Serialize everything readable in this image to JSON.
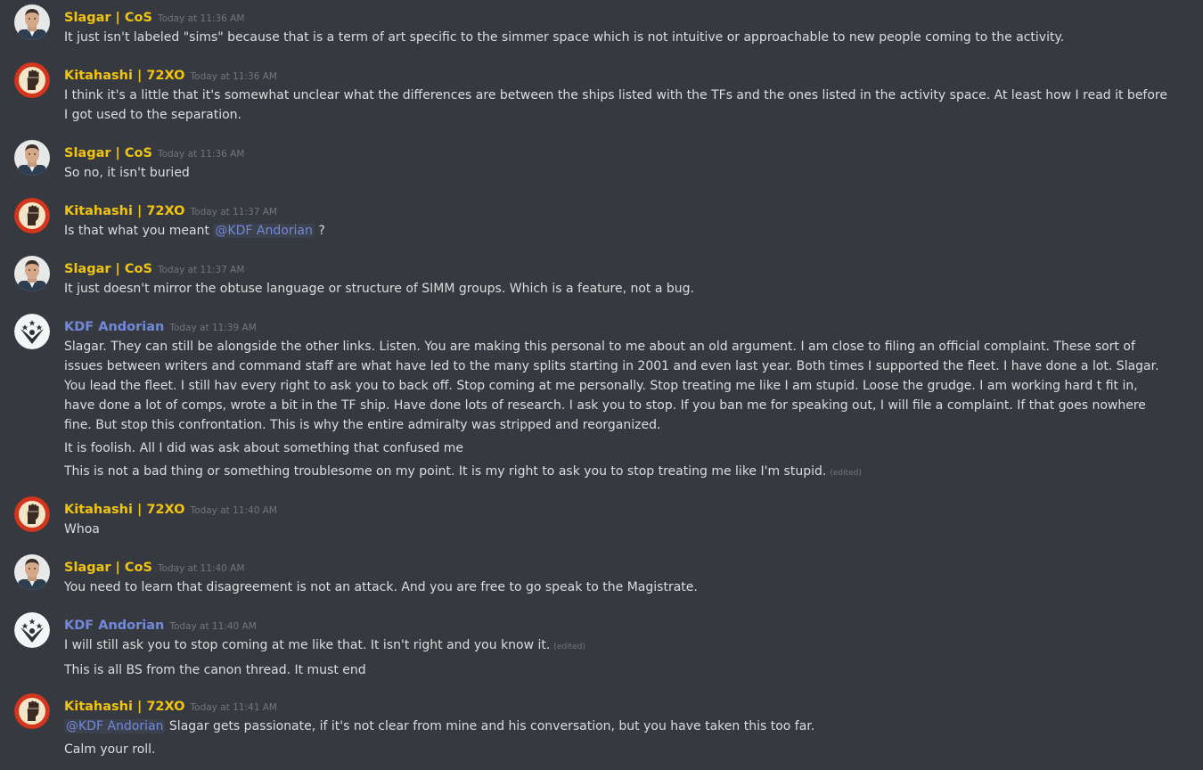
{
  "colors": {
    "background": "#36393f",
    "text": "#dcddde",
    "timestamp": "#72767d",
    "mention": "#7289da",
    "username_gold": "#f1c40f",
    "username_blue": "#7289da"
  },
  "messages": [
    {
      "author": "Slagar | CoS",
      "author_color": "#f1c40f",
      "avatar": "slagar-avatar",
      "time": "Today at 11:36 AM",
      "lines": [
        {
          "text": "It just isn't labeled \"sims\" because that is a term of art specific to the simmer space which is not intuitive or approachable to new people coming to the activity."
        }
      ]
    },
    {
      "author": "Kitahashi | 72XO",
      "author_color": "#f1c40f",
      "avatar": "fist-avatar",
      "time": "Today at 11:36 AM",
      "lines": [
        {
          "text": "I think it's a little that it's somewhat unclear what the differences are between the ships listed with the TFs and the ones listed in the activity space. At least how I read it before I got used to the separation."
        }
      ]
    },
    {
      "author": "Slagar | CoS",
      "author_color": "#f1c40f",
      "avatar": "slagar-avatar",
      "time": "Today at 11:36 AM",
      "lines": [
        {
          "text": "So no, it isn't buried"
        }
      ]
    },
    {
      "author": "Kitahashi | 72XO",
      "author_color": "#f1c40f",
      "avatar": "fist-avatar",
      "time": "Today at 11:37 AM",
      "lines": [
        {
          "before": "Is that what you meant ",
          "mention": "@KDF Andorian",
          "text": " ?"
        }
      ]
    },
    {
      "author": "Slagar | CoS",
      "author_color": "#f1c40f",
      "avatar": "slagar-avatar",
      "time": "Today at 11:37 AM",
      "lines": [
        {
          "text": "It just doesn't mirror the obtuse language or structure of SIMM groups. Which is a feature, not a bug."
        }
      ]
    },
    {
      "author": "KDF Andorian",
      "author_color": "#7289da",
      "avatar": "kdf-avatar",
      "time": "Today at 11:39 AM",
      "lines": [
        {
          "text": "Slagar. They can still be alongside the other links. Listen. You are making this personal to me about an old argument. I am close to filing an official complaint. These sort of issues between writers and command staff are what have led to the many splits starting in 2001 and even last year. Both times I supported the fleet. I have done a lot. Slagar. You lead the fleet. I still hav every right to ask you to back off. Stop coming at me personally. Stop treating me like I am stupid. Loose the grudge. I am working hard t fit in, have done a lot of comps, wrote a bit in the TF ship. Have done lots of research. I ask you to stop. If you ban me for speaking out, I will file a complaint. If that goes nowhere fine. But stop this confrontation. This is why the entire admiralty was stripped and reorganized."
        },
        {
          "text": "It is foolish. All I did was ask about something that confused me"
        },
        {
          "text": "This is not a bad thing or something troublesome on my point. It is my right to ask you to stop treating me like I'm stupid.",
          "edited": "(edited)"
        }
      ]
    },
    {
      "author": "Kitahashi | 72XO",
      "author_color": "#f1c40f",
      "avatar": "fist-avatar",
      "time": "Today at 11:40 AM",
      "lines": [
        {
          "text": "Whoa"
        }
      ]
    },
    {
      "author": "Slagar | CoS",
      "author_color": "#f1c40f",
      "avatar": "slagar-avatar",
      "time": "Today at 11:40 AM",
      "lines": [
        {
          "text": "You need to learn that disagreement is not an attack. And you are free to go speak to the Magistrate."
        }
      ]
    },
    {
      "author": "KDF Andorian",
      "author_color": "#7289da",
      "avatar": "kdf-avatar",
      "time": "Today at 11:40 AM",
      "lines": [
        {
          "text": "I will still ask you to stop coming at me like that. It isn't right and you know it.",
          "edited": "(edited)"
        },
        {
          "text": "This is all BS from the canon thread. It must end"
        }
      ]
    },
    {
      "author": "Kitahashi | 72XO",
      "author_color": "#f1c40f",
      "avatar": "fist-avatar",
      "time": "Today at 11:41 AM",
      "lines": [
        {
          "before": "",
          "mention": "@KDF Andorian",
          "text": " Slagar gets passionate, if it's not clear from mine and his conversation, but you have taken this too far."
        },
        {
          "text": "Calm your roll."
        }
      ]
    }
  ]
}
